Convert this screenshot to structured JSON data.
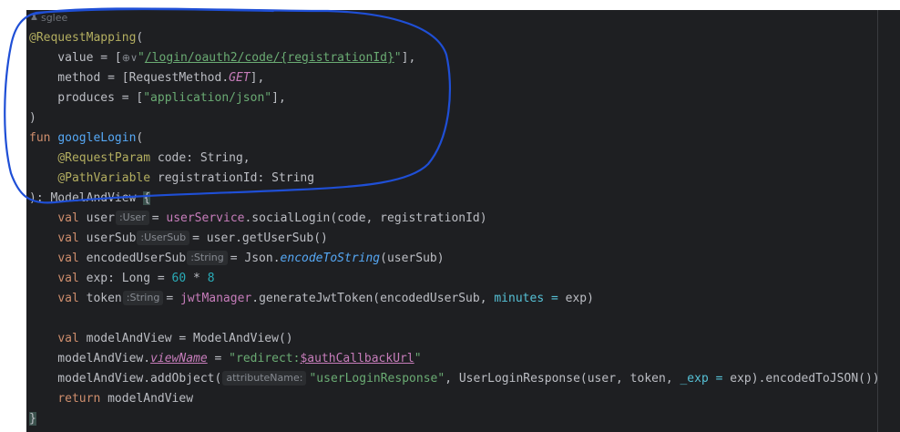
{
  "editor": {
    "author": "sglee",
    "lines": [
      [
        {
          "t": "@RequestMapping",
          "c": "ann"
        },
        {
          "t": "("
        }
      ],
      [
        {
          "t": "    value = ["
        },
        {
          "hint": "⊕∨"
        },
        {
          "t": "\"",
          "c": "str"
        },
        {
          "t": "/login/oauth2/code/{registrationId}",
          "c": "str und"
        },
        {
          "t": "\"",
          "c": "str"
        },
        {
          "t": "],"
        }
      ],
      [
        {
          "t": "    method = [RequestMethod."
        },
        {
          "t": "GET",
          "c": "prop ital"
        },
        {
          "t": "],"
        }
      ],
      [
        {
          "t": "    produces = ["
        },
        {
          "t": "\"application/json\"",
          "c": "str"
        },
        {
          "t": "],"
        }
      ],
      [
        {
          "t": ")"
        }
      ],
      [
        {
          "t": "fun ",
          "c": "kw"
        },
        {
          "t": "googleLogin",
          "c": "fn"
        },
        {
          "t": "("
        }
      ],
      [
        {
          "t": "    "
        },
        {
          "t": "@RequestParam",
          "c": "ann"
        },
        {
          "t": " code: String,"
        }
      ],
      [
        {
          "t": "    "
        },
        {
          "t": "@PathVariable",
          "c": "ann"
        },
        {
          "t": " registrationId: String"
        }
      ],
      [
        {
          "t": "): ModelAndView "
        },
        {
          "t": "{",
          "c": "brace-hl"
        }
      ],
      [
        {
          "t": "    "
        },
        {
          "t": "val ",
          "c": "kw"
        },
        {
          "t": "user"
        },
        {
          "chip": ":User"
        },
        {
          "t": "= "
        },
        {
          "t": "userService",
          "c": "prop"
        },
        {
          "t": ".socialLogin(code, registrationId)"
        }
      ],
      [
        {
          "t": "    "
        },
        {
          "t": "val ",
          "c": "kw"
        },
        {
          "t": "userSub"
        },
        {
          "chip": ":UserSub"
        },
        {
          "t": "= user.getUserSub()"
        }
      ],
      [
        {
          "t": "    "
        },
        {
          "t": "val ",
          "c": "kw"
        },
        {
          "t": "encodedUserSub"
        },
        {
          "chip": ":String"
        },
        {
          "t": "= Json."
        },
        {
          "t": "encodeToString",
          "c": "static"
        },
        {
          "t": "(userSub)"
        }
      ],
      [
        {
          "t": "    "
        },
        {
          "t": "val ",
          "c": "kw"
        },
        {
          "t": "exp: Long = "
        },
        {
          "t": "60",
          "c": "num"
        },
        {
          "t": " * "
        },
        {
          "t": "8",
          "c": "num"
        }
      ],
      [
        {
          "t": "    "
        },
        {
          "t": "val ",
          "c": "kw"
        },
        {
          "t": "token"
        },
        {
          "chip": ":String"
        },
        {
          "t": "= "
        },
        {
          "t": "jwtManager",
          "c": "prop"
        },
        {
          "t": ".generateJwtToken(encodedUserSub, "
        },
        {
          "t": "minutes = ",
          "c": "named"
        },
        {
          "t": "exp)"
        }
      ],
      [
        {
          "t": ""
        }
      ],
      [
        {
          "t": "    "
        },
        {
          "t": "val ",
          "c": "kw"
        },
        {
          "t": "modelAndView = ModelAndView()"
        }
      ],
      [
        {
          "t": "    modelAndView."
        },
        {
          "t": "viewName",
          "c": "prop ital und"
        },
        {
          "t": " = "
        },
        {
          "t": "\"redirect:",
          "c": "str"
        },
        {
          "t": "$authCallbackUrl",
          "c": "tmpl und"
        },
        {
          "t": "\"",
          "c": "str"
        }
      ],
      [
        {
          "t": "    modelAndView.addObject("
        },
        {
          "chip": "attributeName:"
        },
        {
          "t": "\"userLoginResponse\"",
          "c": "str"
        },
        {
          "t": ", UserLoginResponse(user, token, "
        },
        {
          "t": "_exp = ",
          "c": "named"
        },
        {
          "t": "exp).encodedToJSON())"
        }
      ],
      [
        {
          "t": "    "
        },
        {
          "t": "return ",
          "c": "kw"
        },
        {
          "t": "modelAndView"
        }
      ],
      [
        {
          "t": "}",
          "c": "brace-hl"
        }
      ]
    ]
  },
  "annotation_color": "#1f4fd6"
}
